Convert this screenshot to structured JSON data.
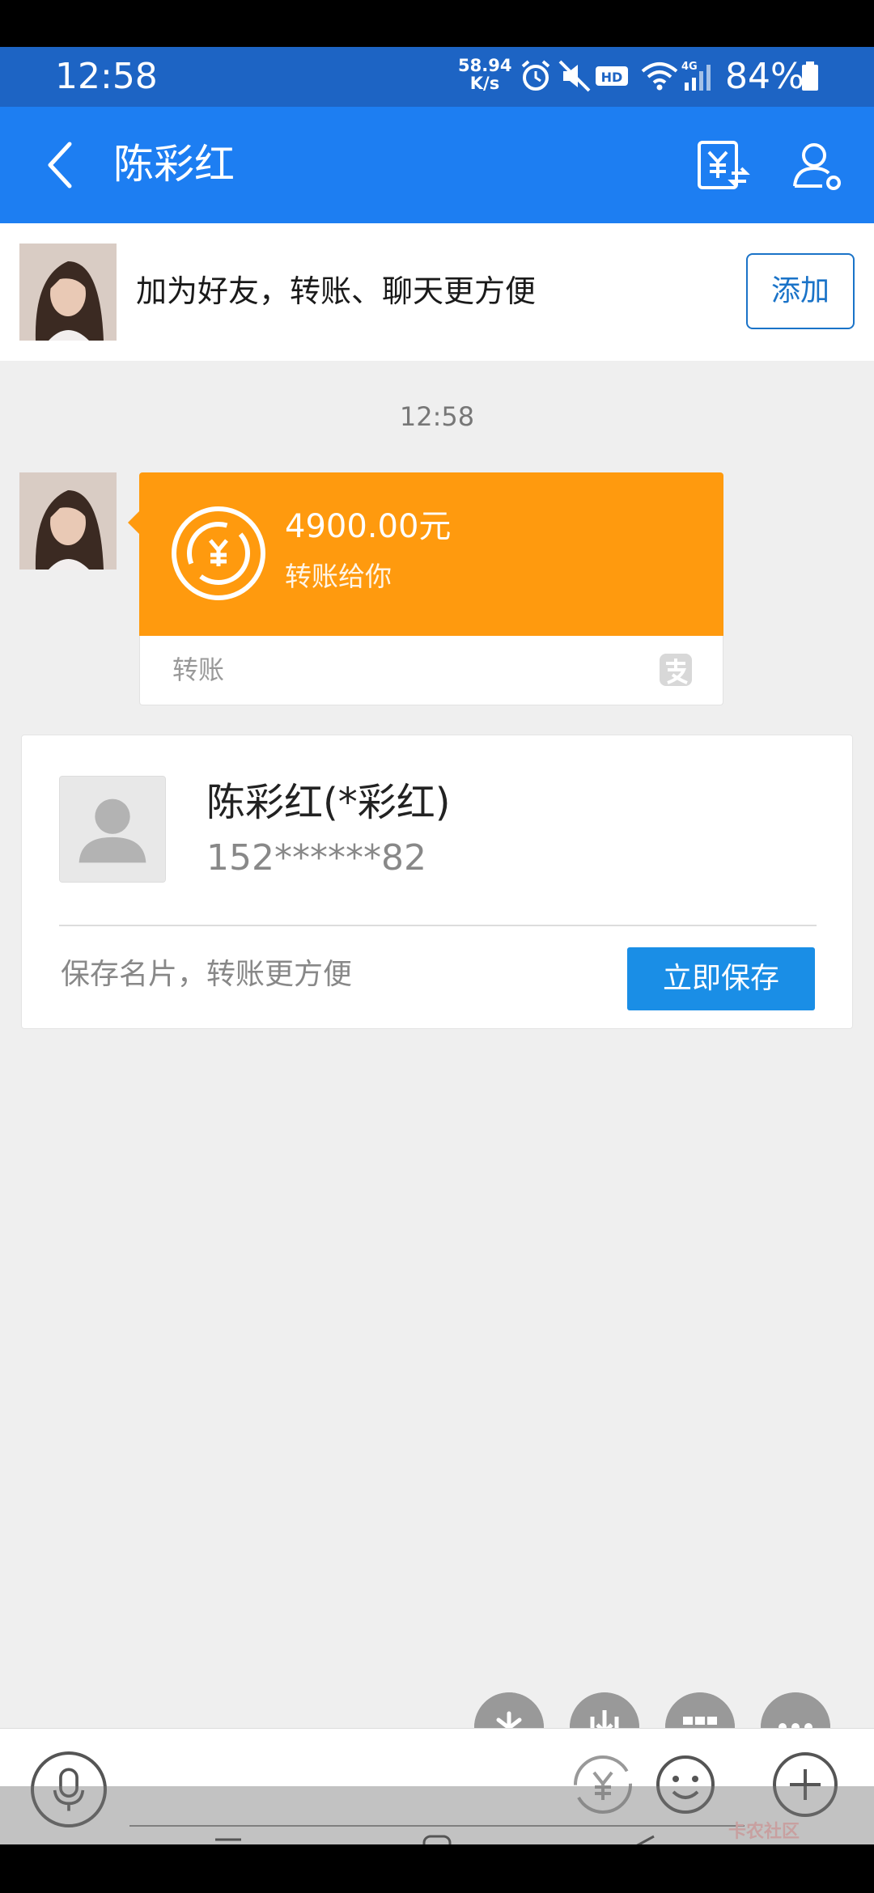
{
  "status_bar": {
    "time": "12:58",
    "net_speed_value": "58.94",
    "net_speed_unit": "K/s",
    "battery": "84%",
    "icons": [
      "alarm-icon",
      "mute-icon",
      "hd-icon",
      "wifi-icon",
      "signal-4g-icon",
      "battery-icon"
    ]
  },
  "header": {
    "title": "陈彩红",
    "icons": [
      "back-arrow-icon",
      "transfer-yuan-icon",
      "profile-icon"
    ]
  },
  "friend_banner": {
    "text": "加为好友，转账、聊天更方便",
    "add_label": "添加"
  },
  "chat": {
    "timestamp": "12:58",
    "transfer": {
      "amount": "4900.00元",
      "subtitle": "转账给你",
      "footer_label": "转账"
    },
    "contact_card": {
      "name": "陈彩红(*彩红)",
      "phone": "152******82",
      "hint": "保存名片，转账更方便",
      "save_label": "立即保存"
    }
  },
  "input_bar": {
    "icons": [
      "microphone-icon",
      "yuan-icon",
      "emoji-icon",
      "plus-icon"
    ],
    "quick_actions": [
      "sparkle-icon",
      "download-icon",
      "grid-icon",
      "more-icon"
    ]
  },
  "watermark": "卡农社区",
  "colors": {
    "status_bar_bg": "#1d64c4",
    "header_bg": "#1d7ef2",
    "transfer_orange": "#ff9a0e",
    "save_button_blue": "#1a8ee6",
    "add_button_border": "#1a73c8"
  }
}
